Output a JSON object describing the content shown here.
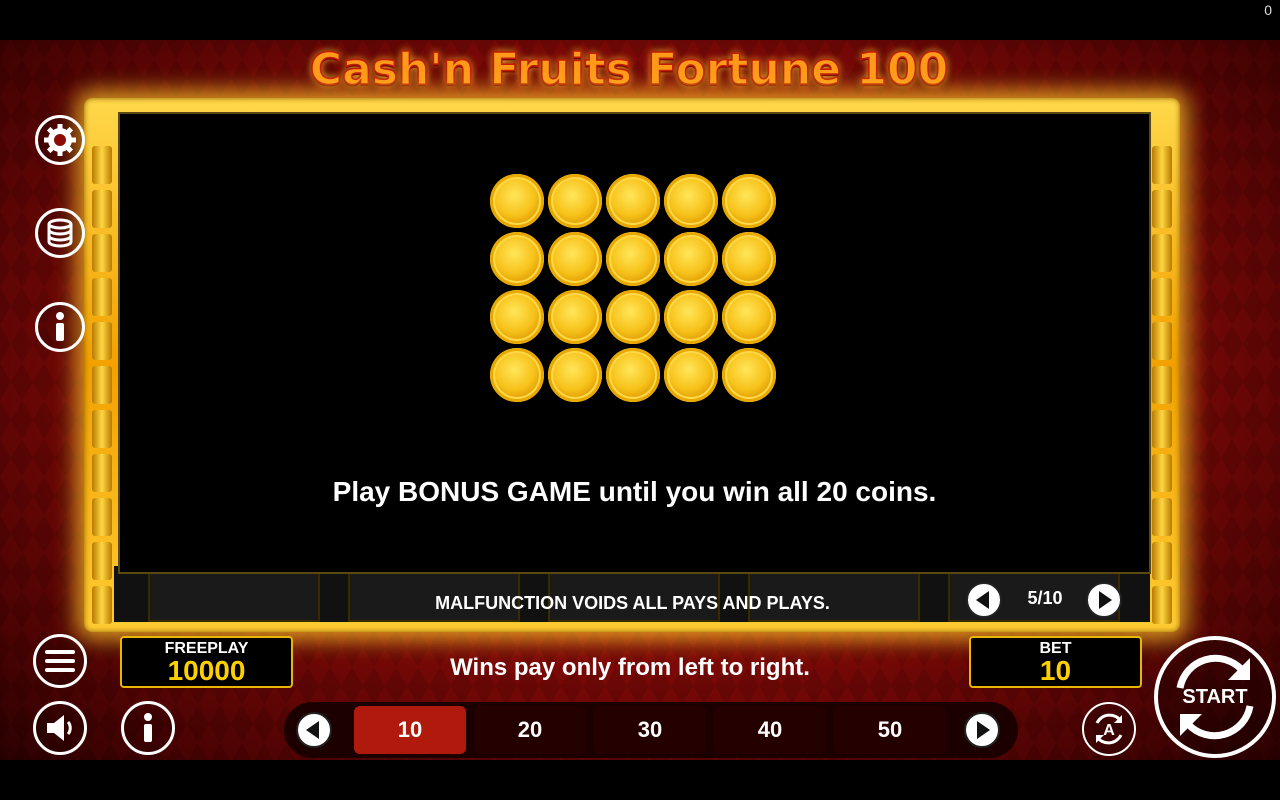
{
  "game": {
    "title": "Cash'n Fruits Fortune 100",
    "top_right_counter": "0"
  },
  "info_popup": {
    "coin_count": 20,
    "message": "Play BONUS GAME until you win all 20 coins.",
    "page_indicator": "5/10"
  },
  "notices": {
    "malfunction": "MALFUNCTION VOIDS ALL PAYS AND PLAYS.",
    "wins_rule": "Wins pay only from left to right."
  },
  "balance": {
    "label": "FREEPLAY",
    "value": "10000"
  },
  "bet": {
    "label": "BET",
    "value": "10",
    "options": [
      "10",
      "20",
      "30",
      "40",
      "50"
    ],
    "selected": "10"
  },
  "start_button": {
    "label": "START"
  },
  "icons": {
    "settings": "gear-icon",
    "coins": "coin-stack-icon",
    "info": "info-icon",
    "menu": "hamburger-menu-icon",
    "sound": "speaker-icon",
    "autoplay": "autoplay-icon"
  },
  "colors": {
    "frame_gold": "#f2a100",
    "selected_bet": "#b01a0d",
    "value_yellow": "#ffd000",
    "background_red": "#8a0b08"
  }
}
